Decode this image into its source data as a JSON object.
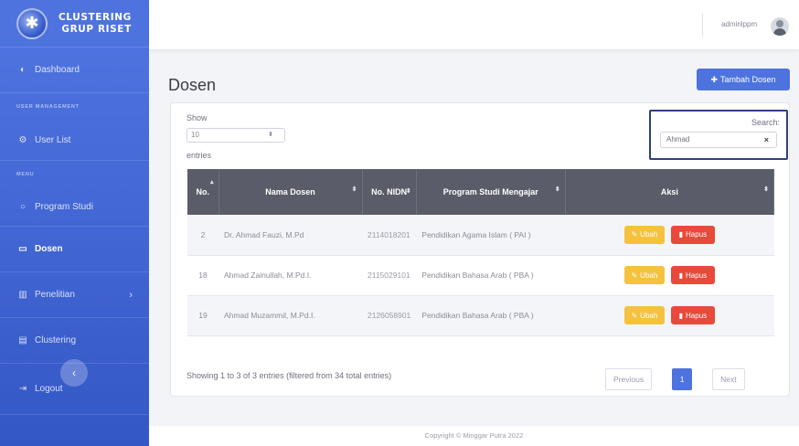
{
  "brand": {
    "line1": "CLUSTERING",
    "line2": "GRUP RISET"
  },
  "sidebar": {
    "dashboard": "Dashboard",
    "heading_user": "USER MANAGEMENT",
    "user_list": "User List",
    "heading_menu": "MENU",
    "program_studi": "Program Studi",
    "dosen": "Dosen",
    "penelitian": "Penelitian",
    "clustering": "Clustering",
    "logout": "Logout"
  },
  "topbar": {
    "username": "adminlppm"
  },
  "page": {
    "title": "Dosen",
    "add_button": "Tambah Dosen"
  },
  "datatable": {
    "show_label": "Show",
    "length_value": "10",
    "entries_label": "entries",
    "search_label": "Search:",
    "search_value": "Ahmad",
    "columns": [
      "No.",
      "Nama Dosen",
      "No. NIDN",
      "Program Studi Mengajar",
      "Aksi"
    ],
    "rows": [
      {
        "no": "2",
        "nama": "Dr. Ahmad Fauzi, M.Pd",
        "nidn": "2114018201",
        "prodi": "Pendidikan Agama Islam ( PAI )"
      },
      {
        "no": "18",
        "nama": "Ahmad Zainullah, M.Pd.I.",
        "nidn": "2115029101",
        "prodi": "Pendidikan Bahasa Arab ( PBA )"
      },
      {
        "no": "19",
        "nama": "Ahmad Muzammil, M.Pd.I.",
        "nidn": "2126058901",
        "prodi": "Pendidikan Bahasa Arab ( PBA )"
      }
    ],
    "edit_label": "Ubah",
    "delete_label": "Hapus",
    "info": "Showing 1 to 3 of 3 entries (filtered from 34 total entries)",
    "prev": "Previous",
    "current_page": "1",
    "next": "Next"
  },
  "footer": "Copyright © Minggar Putra 2022",
  "colors": {
    "primary": "#4e73df",
    "warning": "#f6c23e",
    "danger": "#e74a3b",
    "table_header": "#5a5c69"
  }
}
